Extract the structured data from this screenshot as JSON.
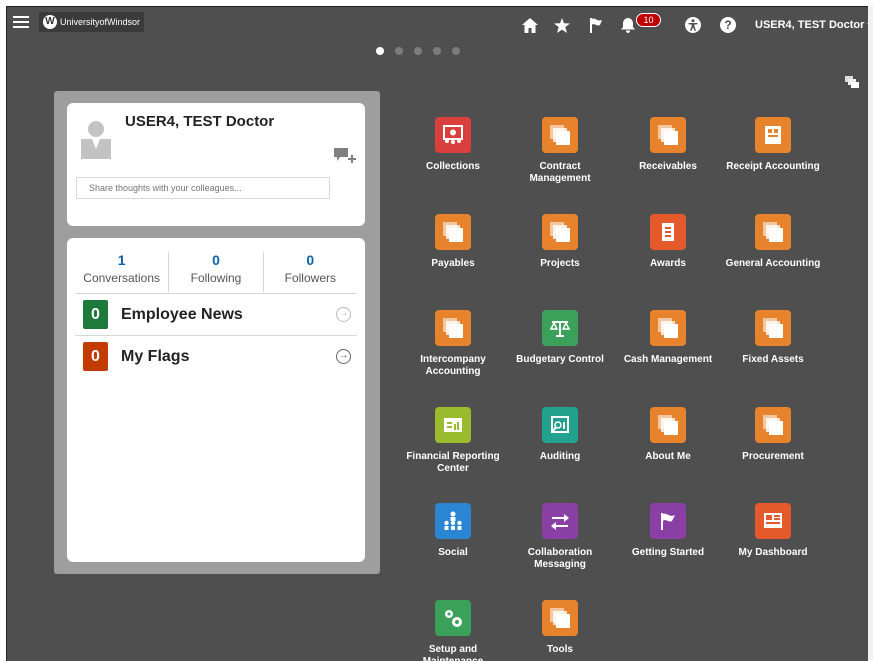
{
  "header": {
    "logo_text": "UniversityofWindsor",
    "logo_badge": "W",
    "notification_count": "10",
    "help_label": "?",
    "user_menu_label": "USER4, TEST Doctor"
  },
  "carousel": {
    "page_count": 5,
    "active_index": 0
  },
  "profile": {
    "name": "USER4, TEST Doctor",
    "share_placeholder": "Share thoughts with your colleagues..."
  },
  "stats": [
    {
      "value": "1",
      "label": "Conversations"
    },
    {
      "value": "0",
      "label": "Following"
    },
    {
      "value": "0",
      "label": "Followers"
    }
  ],
  "activity": [
    {
      "count": "0",
      "label": "Employee News",
      "color": "#1e7a3b"
    },
    {
      "count": "0",
      "label": "My Flags",
      "color": "#c23b00"
    }
  ],
  "colors": {
    "background": "#4f4f4f",
    "orange": "#e8832d",
    "red": "#d9403d",
    "green": "#3aa05a",
    "lime": "#9bbb2f",
    "teal": "#22a18e",
    "blue": "#2a86d2",
    "purple": "#8a3fa4",
    "orange_red": "#e45a2c"
  },
  "apps": [
    {
      "label": "Collections",
      "icon": "collections-icon",
      "color": "#d9403d"
    },
    {
      "label": "Contract Management",
      "icon": "stack-icon",
      "color": "#e8832d"
    },
    {
      "label": "Receivables",
      "icon": "stack-icon",
      "color": "#e8832d"
    },
    {
      "label": "Receipt Accounting",
      "icon": "receipt-icon",
      "color": "#e8832d"
    },
    {
      "label": "Payables",
      "icon": "stack-icon",
      "color": "#e8832d"
    },
    {
      "label": "Projects",
      "icon": "stack-icon",
      "color": "#e8832d"
    },
    {
      "label": "Awards",
      "icon": "document-icon",
      "color": "#e45a2c"
    },
    {
      "label": "General Accounting",
      "icon": "stack-icon",
      "color": "#e8832d"
    },
    {
      "label": "Intercompany Accounting",
      "icon": "stack-icon",
      "color": "#e8832d"
    },
    {
      "label": "Budgetary Control",
      "icon": "scales-icon",
      "color": "#3aa05a"
    },
    {
      "label": "Cash Management",
      "icon": "stack-icon",
      "color": "#e8832d"
    },
    {
      "label": "Fixed Assets",
      "icon": "stack-icon",
      "color": "#e8832d"
    },
    {
      "label": "Financial Reporting Center",
      "icon": "report-icon",
      "color": "#9bbb2f"
    },
    {
      "label": "Auditing",
      "icon": "magnifier-chart-icon",
      "color": "#22a18e"
    },
    {
      "label": "About Me",
      "icon": "stack-icon",
      "color": "#e8832d"
    },
    {
      "label": "Procurement",
      "icon": "stack-icon",
      "color": "#e8832d"
    },
    {
      "label": "Social",
      "icon": "people-network-icon",
      "color": "#2a86d2"
    },
    {
      "label": "Collaboration Messaging",
      "icon": "exchange-arrows-icon",
      "color": "#8a3fa4"
    },
    {
      "label": "Getting Started",
      "icon": "flag-icon",
      "color": "#8a3fa4"
    },
    {
      "label": "My Dashboard",
      "icon": "dashboard-icon",
      "color": "#e45a2c"
    },
    {
      "label": "Setup and Maintenance",
      "icon": "gears-icon",
      "color": "#3aa05a"
    },
    {
      "label": "Tools",
      "icon": "stack-icon",
      "color": "#e8832d"
    }
  ]
}
